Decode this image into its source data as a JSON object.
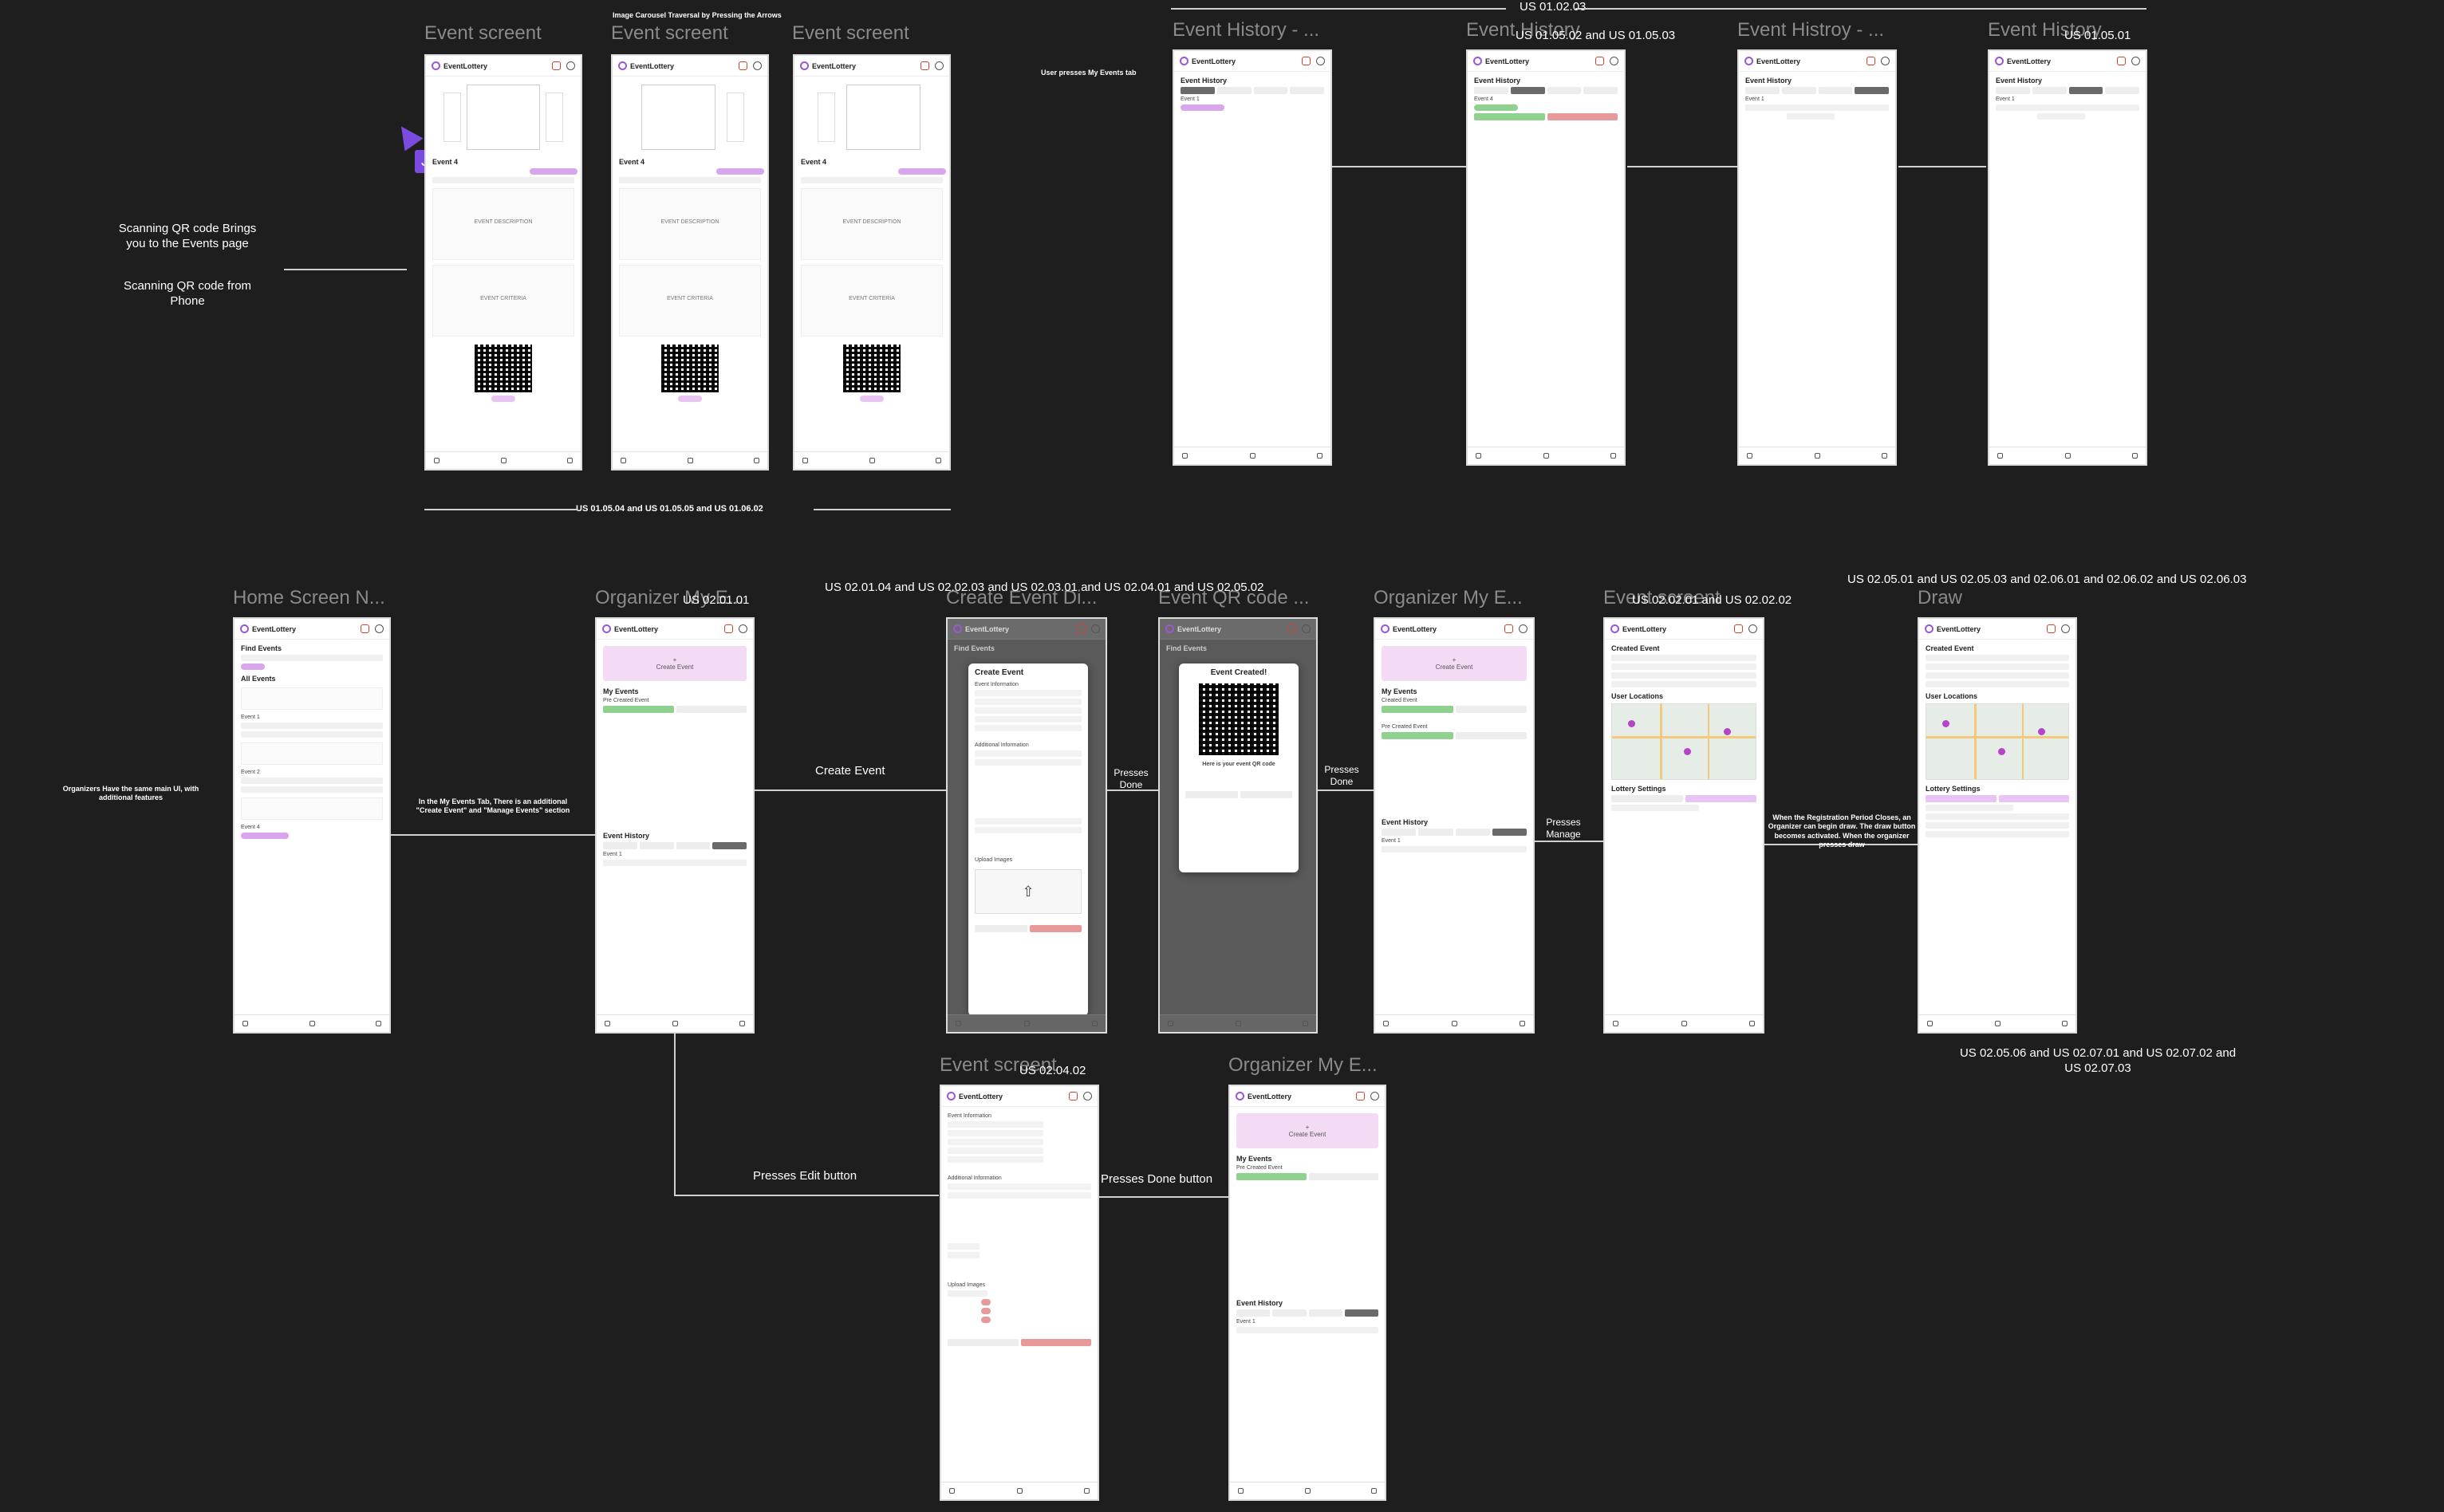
{
  "app": {
    "name": "EventLottery"
  },
  "frames": {
    "f1": "Event screent",
    "f2": "Event screent",
    "f3": "Event screent",
    "f4": "Event History - ...",
    "f5": "Event History",
    "f6": "Event Histroy - ...",
    "f7": "Event History",
    "f8": "Home Screen N...",
    "f9": "Organizer My E...",
    "f10": "Create Event Di...",
    "f11": "Event QR code ...",
    "f12": "Organizer My E...",
    "f13": "Event screent",
    "f14": "Draw",
    "f15": "Event screent",
    "f16": "Organizer My E..."
  },
  "notes": {
    "carousel": "Image Carousel Traversal by Pressing the Arrows",
    "scan1": "Scanning QR code Brings you to the Events page",
    "scan2": "Scanning QR code from Phone",
    "us_top1": "US 01.05.04 and US 01.05.05 and US 01.06.02",
    "my_events_tab": "User presses My Events tab",
    "us_010203": "US 01.02.03",
    "us_010502": "US 01.05.02 and US 01.05.03",
    "us_010501": "US 01.05.01",
    "organizers_same": "Organizers Have the same main UI, with additional features",
    "my_events_extra": "In the My Events Tab, There is an additional \"Create Event\" and \"Manage Events\" section",
    "us_020101": "US 02.01.01",
    "us_create_chain": "US 02.01.04 and US 02.02.03 and US 02.03.01 and US 02.04.01 and US 02.05.02",
    "create_event": "Create Event",
    "presses_done1": "Presses Done",
    "presses_done2": "Presses Done",
    "presses_manage": "Presses Manage",
    "us_020201": "US 02.02.01 and US 02.02.02",
    "draw_explain": "When the Registration Period Closes, an Organizer can begin draw. The draw button becomes activated. When the organizer presses draw",
    "us_draw_top": "US 02.05.01 and US 02.05.03 and 02.06.01 and 02.06.02 and US 02.06.03",
    "us_draw_bottom": "US 02.05.06 and US 02.07.01 and US 02.07.02 and US 02.07.03",
    "us_020402": "US 02.04.02",
    "presses_edit": "Presses Edit button",
    "presses_done_btn": "Presses Done button"
  },
  "labels": {
    "event4": "Event 4",
    "event_history": "Event History",
    "event1": "Event 1",
    "event2": "Event 2",
    "find_events": "Find Events",
    "all_events": "All Events",
    "my_events": "My Events",
    "pre_created": "Pre Created Event",
    "create_event_btn": "Create Event",
    "event_information": "Event Information",
    "additional_information": "Additional Information",
    "upload_images": "Upload Images",
    "event_created": "Event Created!",
    "qr_caption": "Here is your event QR code",
    "created_event": "Created Event",
    "user_locations": "User Locations",
    "lottery_settings": "Lottery Settings",
    "event_description": "EVENT DESCRIPTION",
    "event_criteria": "EVENT CRITERIA"
  },
  "collaborator": {
    "name": "Jason",
    "color": "#7b4be0"
  }
}
